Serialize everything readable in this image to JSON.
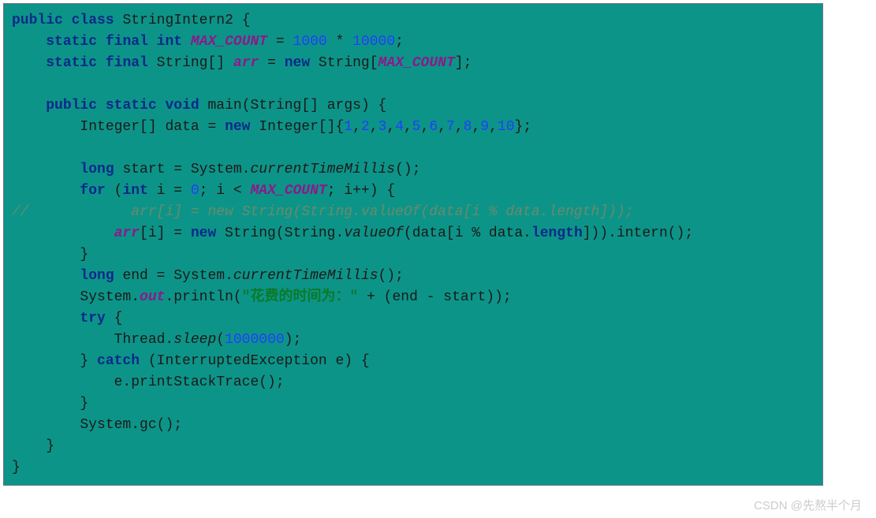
{
  "code": {
    "line1": {
      "kw1": "public",
      "kw2": "class",
      "name": "StringIntern2",
      "brace": " {"
    },
    "line2": {
      "kw1": "static",
      "kw2": "final",
      "kw3": "int",
      "field": "MAX_COUNT",
      "eq": " = ",
      "n1": "1000",
      "op": " * ",
      "n2": "10000",
      "semi": ";"
    },
    "line3": {
      "kw1": "static",
      "kw2": "final",
      "type": "String[]",
      "field": "arr",
      "eq": " = ",
      "kw3": "new",
      "type2": " String[",
      "ref": "MAX_COUNT",
      "close": "];"
    },
    "line4": {
      "kw1": "public",
      "kw2": "static",
      "kw3": "void",
      "name": "main",
      "params": "(String[] args) {"
    },
    "line5": {
      "type": "Integer[] data",
      "eq": " = ",
      "kw": "new",
      "type2": " Integer[]{",
      "n1": "1",
      "c": ",",
      "n2": "2",
      "n3": "3",
      "n4": "4",
      "n5": "5",
      "n6": "6",
      "n7": "7",
      "n8": "8",
      "n9": "9",
      "n10": "10",
      "close": "};"
    },
    "line6": {
      "kw": "long",
      "var": " start = System.",
      "method": "currentTimeMillis",
      "close": "();"
    },
    "line7": {
      "kw1": "for",
      "open": " (",
      "kw2": "int",
      "var": " i = ",
      "n0": "0",
      "cond": "; i < ",
      "ref": "MAX_COUNT",
      "inc": "; i++) {"
    },
    "line8": {
      "prefix": "//",
      "body": "            arr[i] = new String(String.valueOf(data[i % data.length]));"
    },
    "line9": {
      "field": "arr",
      "idx": "[i] = ",
      "kw": "new",
      "type": " String(String.",
      "method": "valueOf",
      "args": "(data[i % data.",
      "prop": "length",
      "close": "])).intern();"
    },
    "line10": {
      "brace": "}"
    },
    "line11": {
      "kw": "long",
      "var": " end = System.",
      "method": "currentTimeMillis",
      "close": "();"
    },
    "line12": {
      "obj": "System.",
      "out": "out",
      "call": ".println(",
      "str": "\"花费的时间为：\"",
      "concat": " + (end - start));"
    },
    "line13": {
      "kw": "try",
      "brace": " {"
    },
    "line14": {
      "obj": "Thread.",
      "method": "sleep",
      "open": "(",
      "n": "1000000",
      "close": ");"
    },
    "line15": {
      "brace": "} ",
      "kw": "catch",
      "args": " (InterruptedException e) {"
    },
    "line16": {
      "body": "e.printStackTrace();"
    },
    "line17": {
      "brace": "}"
    },
    "line18": {
      "body": "System.gc();"
    },
    "line19": {
      "brace": "}"
    },
    "line20": {
      "brace": "}"
    }
  },
  "watermark": "CSDN @先熬半个月"
}
